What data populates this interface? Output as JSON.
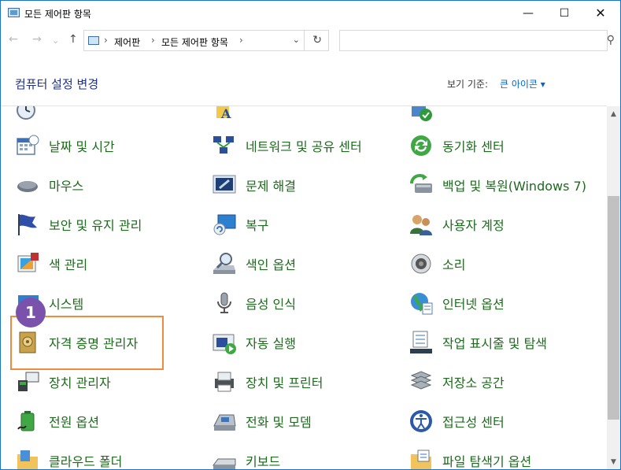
{
  "window": {
    "title": "모든 제어판 항목",
    "controls": {
      "minimize": "—",
      "maximize": "☐",
      "close": "✕"
    }
  },
  "navigation": {
    "back": "←",
    "forward": "→",
    "up": "↑",
    "breadcrumb": [
      "제어판",
      "모든 제어판 항목"
    ],
    "separator": "›",
    "dropdown": "⌄",
    "refresh": "↻",
    "search": {
      "value": "",
      "placeholder": ""
    }
  },
  "header": {
    "title": "컴퓨터 설정 변경",
    "view_by_label": "보기 기준:",
    "view_by_value": "큰 아이콘 ▾"
  },
  "items": [
    {
      "label": "백업 및 복원(Windows 7)",
      "icon": "backup-icon"
    },
    {
      "label": "날짜 및 시간",
      "icon": "calendar-icon"
    },
    {
      "label": "네트워크 및 공유 센터",
      "icon": "network-icon"
    },
    {
      "label": "동기화 센터",
      "icon": "sync-icon"
    },
    {
      "label": "마우스",
      "icon": "mouse-icon"
    },
    {
      "label": "문제 해결",
      "icon": "troubleshoot-icon"
    },
    {
      "label": "보안 및 유지 관리",
      "icon": "flag-icon"
    },
    {
      "label": "복구",
      "icon": "recovery-icon"
    },
    {
      "label": "사용자 계정",
      "icon": "users-icon"
    },
    {
      "label": "색 관리",
      "icon": "color-icon"
    },
    {
      "label": "색인 옵션",
      "icon": "index-icon"
    },
    {
      "label": "소리",
      "icon": "speaker-icon"
    },
    {
      "label": "시스템",
      "icon": "system-icon"
    },
    {
      "label": "음성 인식",
      "icon": "microphone-icon"
    },
    {
      "label": "인터넷 옵션",
      "icon": "globe-icon"
    },
    {
      "label": "자격 증명 관리자",
      "icon": "vault-icon"
    },
    {
      "label": "자동 실행",
      "icon": "autoplay-icon"
    },
    {
      "label": "작업 표시줄 및 탐색",
      "icon": "taskbar-icon"
    },
    {
      "label": "장치 관리자",
      "icon": "device-manager-icon"
    },
    {
      "label": "장치 및 프린터",
      "icon": "printer-icon"
    },
    {
      "label": "저장소 공간",
      "icon": "storage-icon"
    },
    {
      "label": "전원 옵션",
      "icon": "battery-icon"
    },
    {
      "label": "전화 및 모뎀",
      "icon": "phone-icon"
    },
    {
      "label": "접근성 센터",
      "icon": "accessibility-icon"
    },
    {
      "label": "클라우드 폴더",
      "icon": "folder-icon"
    },
    {
      "label": "키보드",
      "icon": "keyboard-icon"
    },
    {
      "label": "파일 탐색기 옵션",
      "icon": "folder-options-icon"
    }
  ],
  "annotation": {
    "step": "1"
  },
  "colors": {
    "link_green": "#1d6a1d",
    "title_blue": "#1e3287",
    "highlight_orange": "#f08a3c",
    "badge_purple": "#7b52ab"
  }
}
